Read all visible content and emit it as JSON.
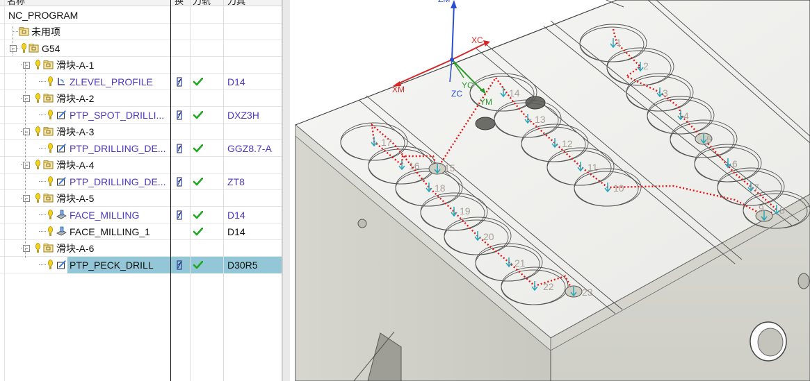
{
  "navigator": {
    "headers": {
      "name": "名称",
      "swap": "换",
      "machine": "刀轨",
      "tool": "刀具"
    },
    "rows": [
      {
        "label": "NC_PROGRAM",
        "color": "black",
        "tool": "",
        "swap": false,
        "check": false,
        "level": 0,
        "type": "root"
      },
      {
        "label": "未用项",
        "color": "black",
        "tool": "",
        "swap": false,
        "check": false,
        "level": 1,
        "type": "folder"
      },
      {
        "label": "G54",
        "color": "black",
        "tool": "",
        "swap": false,
        "check": false,
        "level": 1,
        "type": "group"
      },
      {
        "label": "滑块-A-1",
        "color": "black",
        "tool": "",
        "swap": false,
        "check": false,
        "level": 2,
        "type": "group"
      },
      {
        "label": "ZLEVEL_PROFILE",
        "color": "blue",
        "tool": "D14",
        "swap": true,
        "check": true,
        "level": 3,
        "type": "op-profile"
      },
      {
        "label": "滑块-A-2",
        "color": "black",
        "tool": "",
        "swap": false,
        "check": false,
        "level": 2,
        "type": "group"
      },
      {
        "label": "PTP_SPOT_DRILLI...",
        "color": "blue",
        "tool": "DXZ3H",
        "swap": true,
        "check": true,
        "level": 3,
        "type": "op-drill"
      },
      {
        "label": "滑块-A-3",
        "color": "black",
        "tool": "",
        "swap": false,
        "check": false,
        "level": 2,
        "type": "group"
      },
      {
        "label": "PTP_DRILLING_DE...",
        "color": "blue",
        "tool": "GGZ8.7-A",
        "swap": true,
        "check": true,
        "level": 3,
        "type": "op-drill"
      },
      {
        "label": "滑块-A-4",
        "color": "black",
        "tool": "",
        "swap": false,
        "check": false,
        "level": 2,
        "type": "group"
      },
      {
        "label": "PTP_DRILLING_DE...",
        "color": "blue",
        "tool": "ZT8",
        "swap": true,
        "check": true,
        "level": 3,
        "type": "op-drill"
      },
      {
        "label": "滑块-A-5",
        "color": "black",
        "tool": "",
        "swap": false,
        "check": false,
        "level": 2,
        "type": "group"
      },
      {
        "label": "FACE_MILLING",
        "color": "blue",
        "tool": "D14",
        "swap": true,
        "check": true,
        "level": 3,
        "type": "op-face"
      },
      {
        "label": "FACE_MILLING_1",
        "color": "black",
        "tool": "D14",
        "swap": false,
        "check": true,
        "level": 3,
        "type": "op-face"
      },
      {
        "label": "滑块-A-6",
        "color": "black",
        "tool": "",
        "swap": false,
        "check": false,
        "level": 2,
        "type": "group"
      },
      {
        "label": "PTP_PECK_DRILL",
        "color": "black",
        "tool": "D30R5",
        "swap": true,
        "check": true,
        "level": 3,
        "type": "op-drill",
        "selected": true
      }
    ]
  },
  "viewport": {
    "axes": {
      "xc": "XC",
      "yc": "YC",
      "zc": "ZC",
      "xm": "XM",
      "ym": "YM",
      "zm": "ZM"
    },
    "hole_labels": [
      "1",
      "2",
      "3",
      "4",
      "5",
      "6",
      "7",
      "8",
      "9",
      "10",
      "11",
      "12",
      "13",
      "14",
      "15",
      "16",
      "17",
      "18",
      "19",
      "20",
      "21",
      "22",
      "23"
    ]
  },
  "colors": {
    "selection": "#93c6d6",
    "operation_text": "#4d38c2",
    "check": "#1ea81e",
    "path": "#e01515",
    "axis_x": "#d52a2a",
    "axis_y": "#2a9a2a",
    "axis_z": "#2a4fd0"
  }
}
